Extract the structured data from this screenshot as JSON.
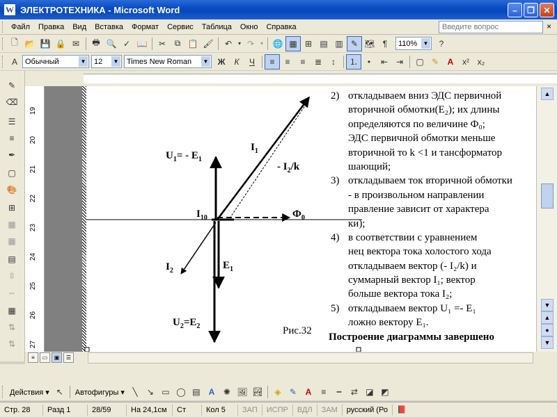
{
  "window": {
    "title": "ЭЛЕКТРОТЕХНИКА - Microsoft Word",
    "app_icon": "W"
  },
  "menu": {
    "items": [
      "Файл",
      "Правка",
      "Вид",
      "Вставка",
      "Формат",
      "Сервис",
      "Таблица",
      "Окно",
      "Справка"
    ],
    "help_placeholder": "Введите вопрос",
    "help_close": "×"
  },
  "toolbar_standard": {
    "zoom": "110%"
  },
  "toolbar_format": {
    "style": "Обычный",
    "size": "12",
    "font": "Times New Roman",
    "bold": "Ж",
    "italic": "К",
    "underline": "Ч"
  },
  "ruler": {
    "vertical_numbers": [
      "19",
      "20",
      "21",
      "22",
      "23",
      "24",
      "25",
      "26",
      "27"
    ]
  },
  "diagram": {
    "labels": {
      "I1": "I",
      "I1_sub": "1",
      "I2k": "- I",
      "I2k_sub": "2",
      "I2k_tail": "/k",
      "U1": "U",
      "U1_sub": "1",
      "U1_tail": "= - E",
      "U1_tail_sub": "1",
      "I10": "I",
      "I10_sub": "10",
      "Phi0": "Ф",
      "Phi0_sub": "0",
      "I2": "I",
      "I2_sub": "2",
      "E1": "E",
      "E1_sub": "1",
      "U2": "U",
      "U2_sub": "2",
      "U2_tail": "=E",
      "U2_tail_sub": "2",
      "caption": "Рис.32"
    }
  },
  "text": {
    "lines": [
      {
        "num": "2)",
        "body": "откладываем вниз  ЭДС первичной"
      },
      {
        "num": "",
        "body": "вторичной обмотки(E₂);  их длины"
      },
      {
        "num": "",
        "body": "определяются по величине  Ф₀;"
      },
      {
        "num": "",
        "body": "ЭДС первичной обмотки меньше"
      },
      {
        "num": "",
        "body": "вторичной то k <1 и тансформатор"
      },
      {
        "num": "",
        "body": "шающий;"
      },
      {
        "num": "3)",
        "body": "откладываем ток вторичной  обмотки"
      },
      {
        "num": "",
        "body": "-  в произвольном  направлении"
      },
      {
        "num": "",
        "body": "правление зависит от характера"
      },
      {
        "num": "",
        "body": "ки);"
      },
      {
        "num": "4)",
        "body": " в соответствии с уравнением"
      },
      {
        "num": "",
        "body": "нец  вектора  тока холостого  хода"
      },
      {
        "num": "",
        "body": "откладываем  вектор (- I₂/k) и"
      },
      {
        "num": "",
        "body": "суммарный  вектор I₁; вектор"
      },
      {
        "num": "",
        "body": "больше вектора тока I₂;"
      },
      {
        "num": "5)",
        "body": "откладываем вектор U₁ =- E₁"
      },
      {
        "num": "",
        "body": "ложно  вектору E₁."
      }
    ],
    "heading": "Построение  диаграммы завершено"
  },
  "drawing": {
    "actions": "Действия ▾",
    "autoshapes": "Автофигуры ▾"
  },
  "status": {
    "page": "Стр.  28",
    "section": "Разд  1",
    "count": "28/59",
    "at": "На 24,1см",
    "line": "Ст",
    "col": "Кол  5",
    "rec": "ЗАП",
    "trk": "ИСПР",
    "ext": "ВДЛ",
    "ovr": "ЗАМ",
    "lang": "русский (Ро"
  }
}
